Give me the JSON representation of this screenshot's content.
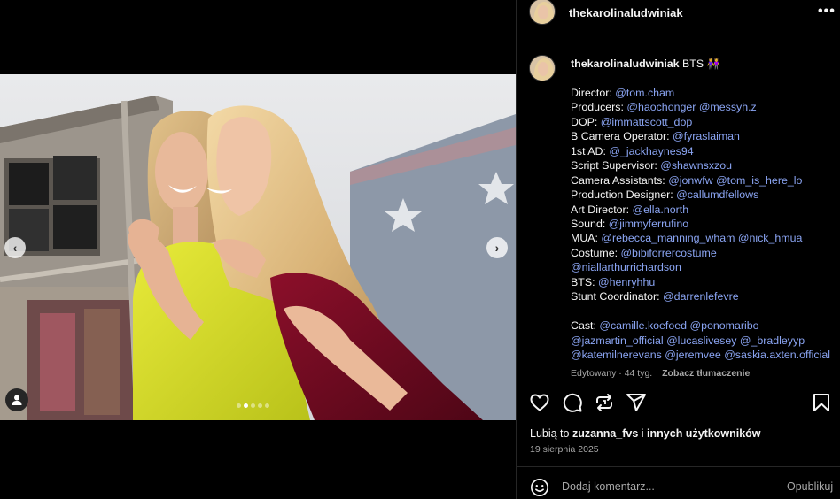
{
  "post": {
    "username": "thekarolinaludwiniak",
    "more_label": "•••"
  },
  "caption": {
    "username": "thekarolinaludwiniak",
    "title": "BTS 👭",
    "credits": [
      {
        "role": "Director: ",
        "mentions": "@tom.cham"
      },
      {
        "role": "Producers: ",
        "mentions": "@haochonger @messyh.z"
      },
      {
        "role": "DOP: ",
        "mentions": "@immattscott_dop"
      },
      {
        "role": "B Camera Operator: ",
        "mentions": "@fyraslaiman"
      },
      {
        "role": "1st AD: ",
        "mentions": "@_jackhaynes94"
      },
      {
        "role": "Script Supervisor: ",
        "mentions": "@shawnsxzou"
      },
      {
        "role": "Camera Assistants: ",
        "mentions": "@jonwfw @tom_is_here_lo"
      },
      {
        "role": "Production Designer: ",
        "mentions": "@callumdfellows"
      },
      {
        "role": "Art Director: ",
        "mentions": "@ella.north"
      },
      {
        "role": "Sound: ",
        "mentions": "@jimmyferrufino"
      },
      {
        "role": "MUA: ",
        "mentions": "@rebecca_manning_wham @nick_hmua"
      },
      {
        "role": "Costume: ",
        "mentions": "@bibiforrercostume"
      },
      {
        "role": "",
        "mentions": "@niallarthurrichardson"
      },
      {
        "role": "BTS: ",
        "mentions": "@henryhhu"
      },
      {
        "role": "Stunt Coordinator: ",
        "mentions": "@darrenlefevre"
      }
    ],
    "cast_label": "Cast: ",
    "cast_lines": [
      "@camille.koefoed @ponomaribo",
      "@jazmartin_official @lucaslivesey @_bradleyyp",
      "@katemilnerevans @jeremvee @saskia.axten.official"
    ],
    "edited": "Edytowany · 44 tyg.",
    "translate": "Zobacz tłumaczenie"
  },
  "likes": {
    "prefix": "Lubią to ",
    "user": "zuzanna_fvs",
    "middle": " i ",
    "others": "innych użytkowników"
  },
  "date": "19 sierpnia 2025",
  "comment": {
    "placeholder": "Dodaj komentarz...",
    "post_label": "Opublikuj"
  },
  "carousel": {
    "total": 5,
    "active_index": 1
  },
  "icons": {
    "like": "heart-icon",
    "comment": "comment-icon",
    "repost": "repost-icon",
    "share": "share-icon",
    "save": "bookmark-icon",
    "emoji": "emoji-icon",
    "tags": "user-tag-icon"
  },
  "colors": {
    "mention": "#8aa4f2",
    "muted": "#a8a8a8",
    "background": "#000000"
  }
}
